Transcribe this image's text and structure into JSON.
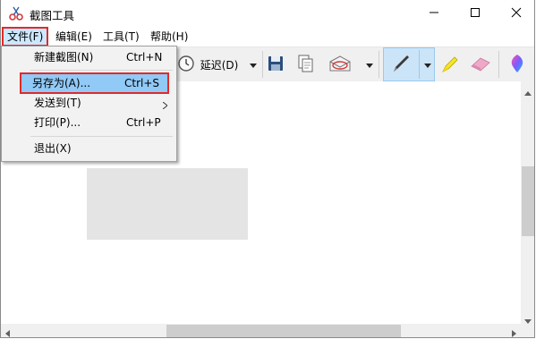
{
  "window": {
    "title": "截图工具"
  },
  "menubar": {
    "items": [
      {
        "label": "文件(F)"
      },
      {
        "label": "编辑(E)"
      },
      {
        "label": "工具(T)"
      },
      {
        "label": "帮助(H)"
      }
    ]
  },
  "toolbar": {
    "delay_label": "延迟(D)"
  },
  "file_menu": {
    "items": [
      {
        "label": "新建截图(N)",
        "shortcut": "Ctrl+N"
      },
      {
        "label": "另存为(A)...",
        "shortcut": "Ctrl+S"
      },
      {
        "label": "发送到(T)",
        "shortcut": ""
      },
      {
        "label": "打印(P)...",
        "shortcut": "Ctrl+P"
      },
      {
        "label": "退出(X)",
        "shortcut": ""
      }
    ]
  },
  "colors": {
    "highlight": "#91c9f7",
    "annotation_red": "#e02a2a",
    "selected_menu": "#cce8ff"
  }
}
